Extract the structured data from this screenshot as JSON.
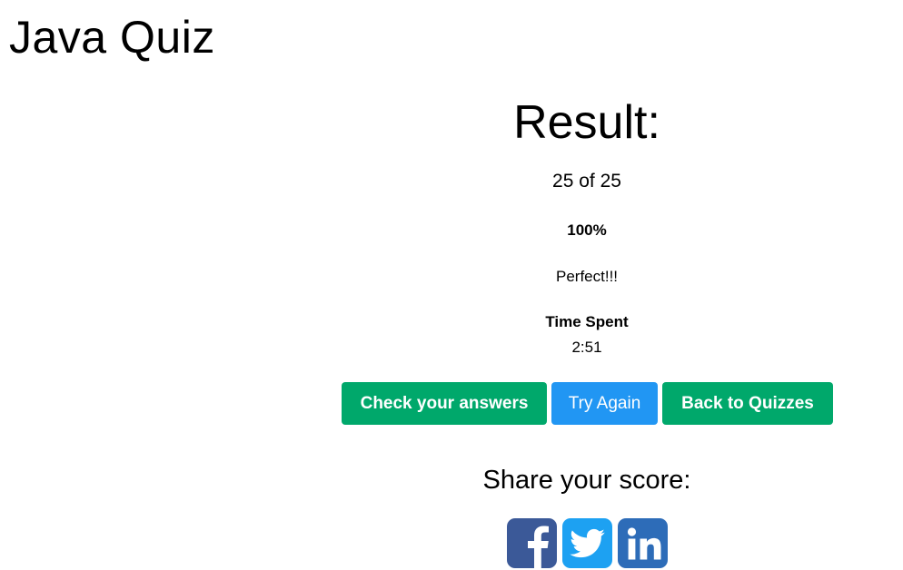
{
  "header": {
    "title": "Java Quiz"
  },
  "result": {
    "heading": "Result:",
    "score_text": "25 of 25",
    "percent_text": "100%",
    "message": "Perfect!!!",
    "time_label": "Time Spent",
    "time_value": "2:51"
  },
  "actions": {
    "check_label": "Check your answers",
    "try_label": "Try Again",
    "back_label": "Back to Quizzes"
  },
  "share": {
    "heading": "Share your score:",
    "icons": [
      "facebook-icon",
      "twitter-icon",
      "linkedin-icon"
    ]
  },
  "colors": {
    "green": "#00a86b",
    "blue": "#2196f3",
    "facebook": "#3b5998",
    "twitter": "#1da1f2",
    "linkedin": "#2d6cb8"
  }
}
